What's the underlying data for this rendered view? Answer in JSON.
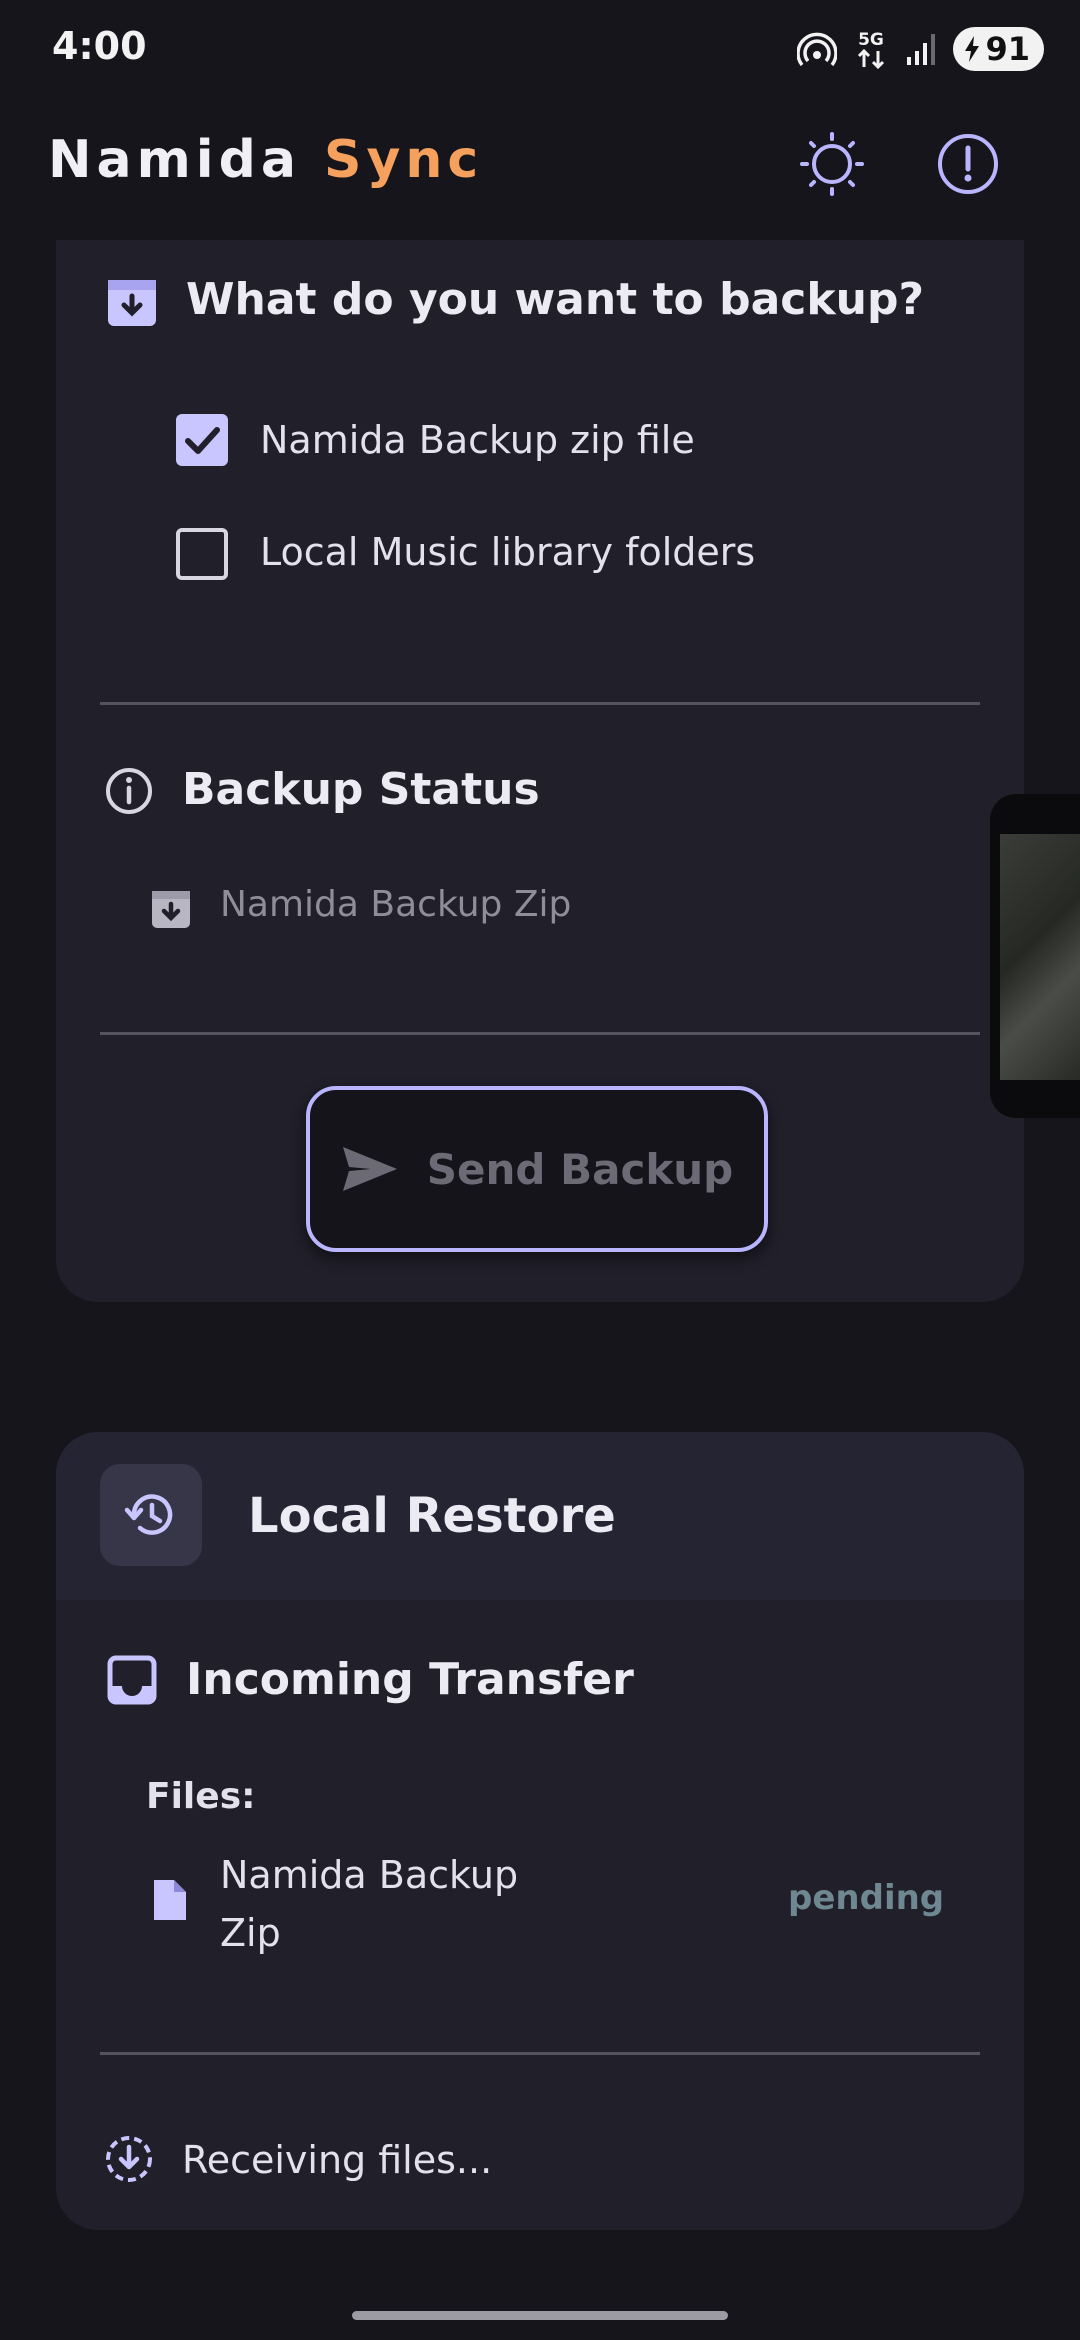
{
  "status_bar": {
    "time": "4:00",
    "network": "5G",
    "battery": "91"
  },
  "app_bar": {
    "title_part1": "Namida",
    "title_part2": "Sync",
    "colors": {
      "title": "#f0eff5",
      "accent": "#f5a05d",
      "icon": "#b9b6ff"
    }
  },
  "backup_card": {
    "question": "What do you want to backup?",
    "options": [
      {
        "label": "Namida Backup zip file",
        "checked": true
      },
      {
        "label": "Local Music library folders",
        "checked": false
      }
    ],
    "status_heading": "Backup Status",
    "status_item": "Namida Backup Zip",
    "send_button": "Send Backup"
  },
  "restore_card": {
    "title": "Local Restore",
    "incoming_heading": "Incoming Transfer",
    "files_label": "Files:",
    "file_name_line1": "Namida Backup",
    "file_name_line2": "Zip",
    "file_status": "pending",
    "receiving": "Receiving files..."
  }
}
